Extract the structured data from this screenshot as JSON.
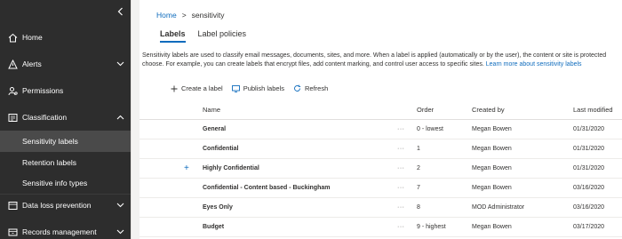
{
  "sidebar": {
    "items": [
      {
        "label": "Home",
        "icon": "home-icon",
        "expandable": false
      },
      {
        "label": "Alerts",
        "icon": "alert-icon",
        "expandable": true,
        "expanded": false
      },
      {
        "label": "Permissions",
        "icon": "permissions-icon",
        "expandable": false
      },
      {
        "label": "Classification",
        "icon": "classification-icon",
        "expandable": true,
        "expanded": true
      },
      {
        "label": "Data loss prevention",
        "icon": "dlp-icon",
        "expandable": true,
        "expanded": false
      },
      {
        "label": "Records management",
        "icon": "records-icon",
        "expandable": true,
        "expanded": false
      }
    ],
    "subitems": [
      {
        "label": "Sensitivity labels",
        "active": true
      },
      {
        "label": "Retention labels",
        "active": false
      },
      {
        "label": "Sensitive info types",
        "active": false
      }
    ]
  },
  "breadcrumb": {
    "home": "Home",
    "separator": ">",
    "current": "sensitivity"
  },
  "tabs": [
    {
      "label": "Labels",
      "active": true
    },
    {
      "label": "Label policies",
      "active": false
    }
  ],
  "description": {
    "line1": "Sensitivity labels are used to classify email messages, documents, sites, and more. When a label is applied (automatically or by the user), the content or site is protected",
    "line2": "choose. For example, you can create labels that encrypt files, add content marking, and control user access to specific sites.",
    "link": "Learn more about sensitivity labels"
  },
  "toolbar": {
    "create": "Create a label",
    "publish": "Publish labels",
    "refresh": "Refresh"
  },
  "table": {
    "columns": {
      "name": "Name",
      "order": "Order",
      "created_by": "Created by",
      "last_modified": "Last modified"
    },
    "more": "···",
    "rows": [
      {
        "name": "General",
        "order": "0 - lowest",
        "created_by": "Megan Bowen",
        "last_modified": "01/31/2020",
        "has_children": false
      },
      {
        "name": "Confidential",
        "order": "1",
        "created_by": "Megan Bowen",
        "last_modified": "01/31/2020",
        "has_children": false
      },
      {
        "name": "Highly Confidential",
        "order": "2",
        "created_by": "Megan Bowen",
        "last_modified": "01/31/2020",
        "has_children": true
      },
      {
        "name": "Confidential - Content based - Buckingham",
        "order": "7",
        "created_by": "Megan Bowen",
        "last_modified": "03/16/2020",
        "has_children": false
      },
      {
        "name": "Eyes Only",
        "order": "8",
        "created_by": "MOD Administrator",
        "last_modified": "03/16/2020",
        "has_children": false
      },
      {
        "name": "Budget",
        "order": "9 - highest",
        "created_by": "Megan Bowen",
        "last_modified": "03/17/2020",
        "has_children": false
      }
    ]
  },
  "colors": {
    "sidebar_bg": "#2d2d2d",
    "accent": "#0f6cbd",
    "active_sub_bg": "#4a4a4a"
  }
}
